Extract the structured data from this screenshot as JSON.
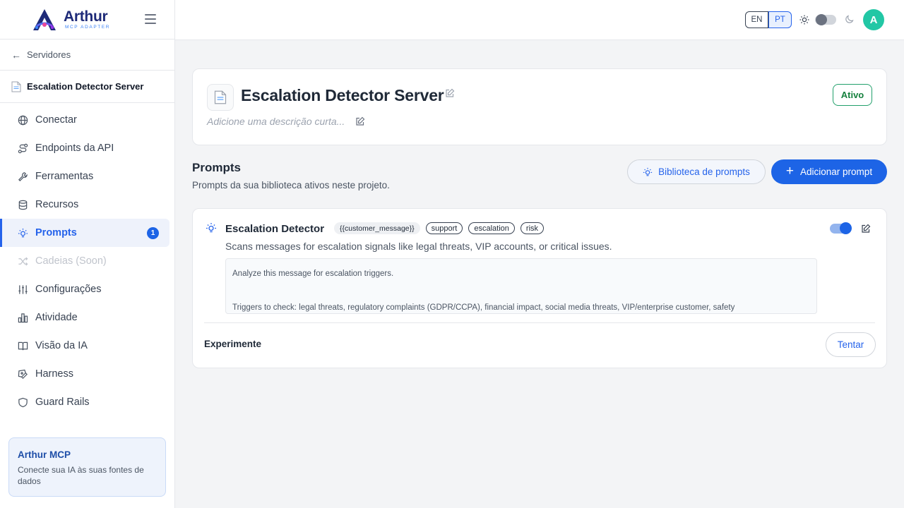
{
  "brand": {
    "name": "Arthur",
    "subtitle": "MCP ADAPTER"
  },
  "sidebar": {
    "back_label": "Servidores",
    "server_name": "Escalation Detector Server",
    "items": [
      {
        "label": "Conectar",
        "icon": "globe-icon"
      },
      {
        "label": "Endpoints da API",
        "icon": "route-icon"
      },
      {
        "label": "Ferramentas",
        "icon": "wrench-icon"
      },
      {
        "label": "Recursos",
        "icon": "database-icon"
      },
      {
        "label": "Prompts",
        "icon": "lightbulb-icon",
        "badge": "1"
      },
      {
        "label": "Cadeias (Soon)",
        "icon": "shuffle-icon"
      },
      {
        "label": "Configurações",
        "icon": "sliders-icon"
      },
      {
        "label": "Atividade",
        "icon": "bar-chart-icon"
      },
      {
        "label": "Visão da IA",
        "icon": "book-icon"
      },
      {
        "label": "Harness",
        "icon": "pen-tool-icon"
      },
      {
        "label": "Guard Rails",
        "icon": "shield-icon"
      }
    ],
    "promo": {
      "title": "Arthur MCP",
      "text": "Conecte sua IA às suas fontes de dados"
    }
  },
  "topbar": {
    "lang_en": "EN",
    "lang_pt": "PT",
    "avatar_initial": "A"
  },
  "server": {
    "title": "Escalation Detector Server",
    "description_placeholder": "Adicione uma descrição curta...",
    "status": "Ativo"
  },
  "prompts_section": {
    "title": "Prompts",
    "subtitle": "Prompts da sua biblioteca ativos neste projeto.",
    "library_button": "Biblioteca de prompts",
    "add_button": "Adicionar prompt"
  },
  "prompt": {
    "name": "Escalation Detector",
    "tags": [
      "{{customer_message}}",
      "support",
      "escalation",
      "risk"
    ],
    "description": "Scans messages for escalation signals like legal threats, VIP accounts, or critical issues.",
    "body_line1": "Analyze this message for escalation triggers.",
    "body_line2": "Triggers to check: legal threats, regulatory complaints (GDPR/CCPA), financial impact, social media threats, VIP/enterprise customer, safety",
    "enabled": true,
    "experiment_label": "Experimente",
    "try_button": "Tentar"
  },
  "colors": {
    "accent": "#1d64e6",
    "active_green": "#15803d",
    "avatar": "#22c7a5"
  }
}
